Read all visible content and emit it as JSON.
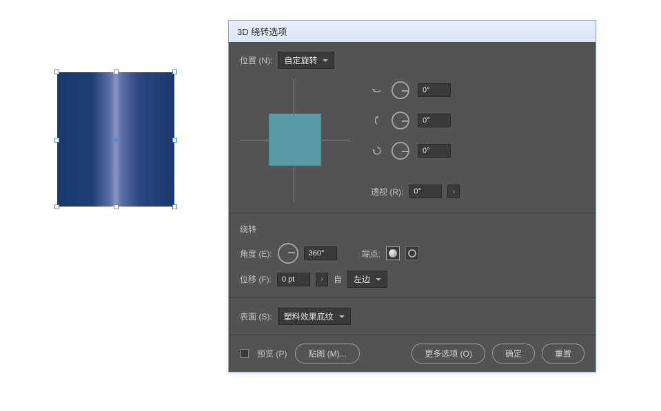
{
  "dialog": {
    "title": "3D 绕转选项",
    "position": {
      "label": "位置 (N):",
      "value": "自定旋转",
      "rot_x": "0°",
      "rot_y": "0°",
      "rot_z": "0°",
      "perspective_label": "透视 (R):",
      "perspective_value": "0°"
    },
    "revolve": {
      "title": "绕转",
      "angle_label": "角度 (E):",
      "angle_value": "360°",
      "cap_label": "端点:",
      "offset_label": "位移 (F):",
      "offset_value": "0 pt",
      "from_label": "自",
      "from_value": "左边"
    },
    "surface": {
      "label": "表面 (S):",
      "value": "塑料效果底纹"
    },
    "footer": {
      "preview_label": "预览 (P)",
      "map_art": "贴图 (M)...",
      "more_options": "更多选项 (O)",
      "ok": "确定",
      "reset": "重置"
    }
  }
}
